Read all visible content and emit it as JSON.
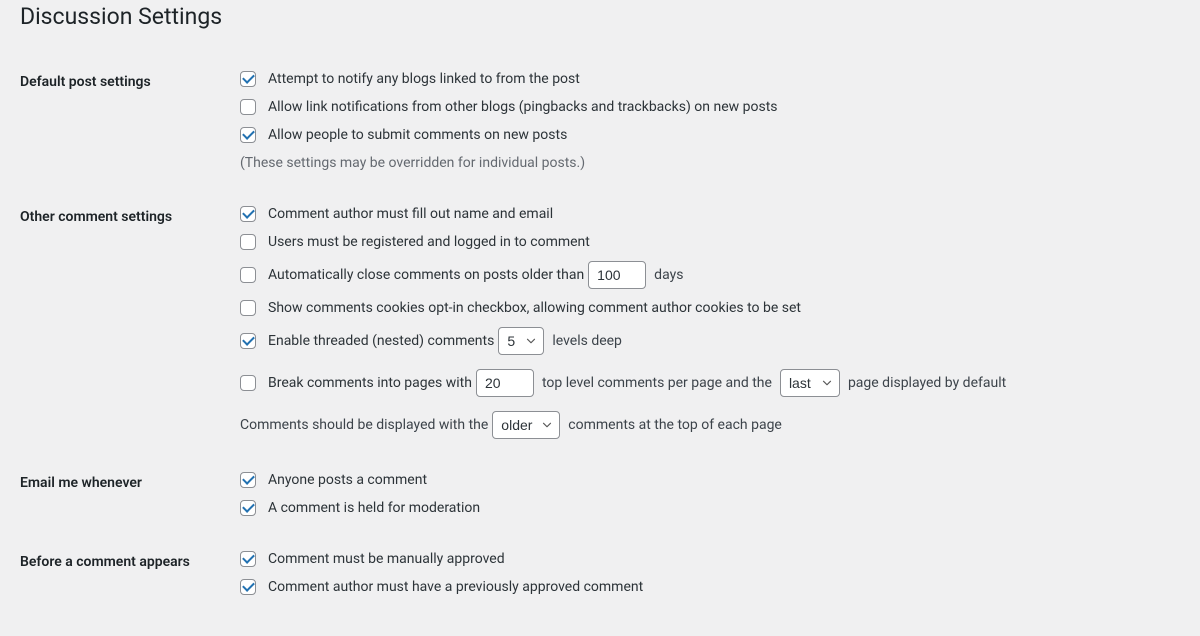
{
  "page_title": "Discussion Settings",
  "sections": {
    "default_post": {
      "label": "Default post settings",
      "notify_blogs": {
        "checked": true,
        "label": "Attempt to notify any blogs linked to from the post"
      },
      "allow_pingbacks": {
        "checked": false,
        "label": "Allow link notifications from other blogs (pingbacks and trackbacks) on new posts"
      },
      "allow_comments": {
        "checked": true,
        "label": "Allow people to submit comments on new posts"
      },
      "help_text": "(These settings may be overridden for individual posts.)"
    },
    "other_comment": {
      "label": "Other comment settings",
      "require_name_email": {
        "checked": true,
        "label": "Comment author must fill out name and email"
      },
      "require_registration": {
        "checked": false,
        "label": "Users must be registered and logged in to comment"
      },
      "auto_close": {
        "checked": false,
        "label_before": "Automatically close comments on posts older than",
        "value": "100",
        "label_after": "days"
      },
      "cookies_optin": {
        "checked": false,
        "label": "Show comments cookies opt-in checkbox, allowing comment author cookies to be set"
      },
      "threaded": {
        "checked": true,
        "label_before": "Enable threaded (nested) comments",
        "value": "5",
        "label_after": "levels deep"
      },
      "paginate": {
        "checked": false,
        "label_before": "Break comments into pages with",
        "per_page": "20",
        "label_mid": "top level comments per page and the",
        "default_page": "last",
        "label_after": "page displayed by default"
      },
      "order": {
        "label_before": "Comments should be displayed with the",
        "value": "older",
        "label_after": "comments at the top of each page"
      }
    },
    "email_me": {
      "label": "Email me whenever",
      "anyone_posts": {
        "checked": true,
        "label": "Anyone posts a comment"
      },
      "held_moderation": {
        "checked": true,
        "label": "A comment is held for moderation"
      }
    },
    "before_appears": {
      "label": "Before a comment appears",
      "manual_approve": {
        "checked": true,
        "label": "Comment must be manually approved"
      },
      "prev_approved": {
        "checked": true,
        "label": "Comment author must have a previously approved comment"
      }
    }
  }
}
